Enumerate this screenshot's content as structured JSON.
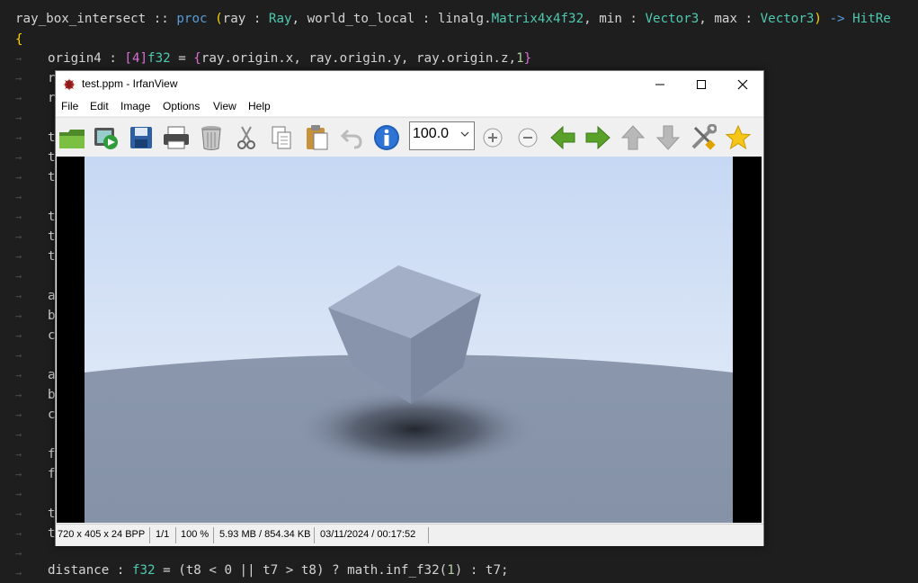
{
  "editor": {
    "line1": {
      "name": "ray_box_intersect",
      "sep": " :: ",
      "proc": "proc",
      "open": " (",
      "p1": "ray",
      "c1": " : ",
      "t1": "Ray",
      "comma1": ", ",
      "p2": "world_to_local",
      "c2": " : ",
      "pkg": "linalg.",
      "t2": "Matrix4x4f32",
      "comma2": ", ",
      "p3": "min",
      "c3": " : ",
      "t3": "Vector3",
      "comma3": ", ",
      "p4": "max",
      "c4": " : ",
      "t4": "Vector3",
      "close": ")",
      "arrow": " -> ",
      "ret": "HitRe"
    },
    "brace_open": "{",
    "line3": {
      "lhs": "origin4",
      "colon": " : ",
      "arr": "[4]",
      "type": "f32",
      "eq": " = ",
      "ob": "{",
      "body": "ray.origin.x, ray.origin.y, ray.origin.z,",
      "one": "1",
      "cb": "}"
    },
    "last_line": {
      "a": "distance",
      "b": " : ",
      "c": "f32",
      "d": " = ",
      "e": "(t8 < 0 || t7 > t8) ? math.inf_f32(",
      "f": "1",
      "g": ") : t7;"
    },
    "visible_letters": [
      "r",
      "r",
      "t",
      "t",
      "t",
      "t",
      "t",
      "t",
      "a",
      "b",
      "c",
      "a",
      "b",
      "c",
      "f",
      "f",
      "t",
      "t"
    ]
  },
  "window": {
    "title": "test.ppm - IrfanView",
    "menu": [
      "File",
      "Edit",
      "Image",
      "Options",
      "View",
      "Help"
    ],
    "zoom_value": "100.0",
    "toolbar_icons": [
      "open-folder-icon",
      "slideshow-icon",
      "save-icon",
      "print-icon",
      "delete-icon",
      "cut-icon",
      "copy-icon",
      "paste-icon",
      "undo-icon",
      "info-icon",
      "zoom-in-icon",
      "zoom-out-icon",
      "previous-icon",
      "next-icon",
      "up-icon",
      "down-icon",
      "settings-icon",
      "favorite-icon"
    ],
    "status": {
      "dimensions": "720 x 405 x 24 BPP",
      "page": "1/1",
      "zoom": "100 %",
      "size": "5.93 MB / 854.34 KB",
      "datetime": "03/11/2024 / 00:17:52"
    }
  }
}
